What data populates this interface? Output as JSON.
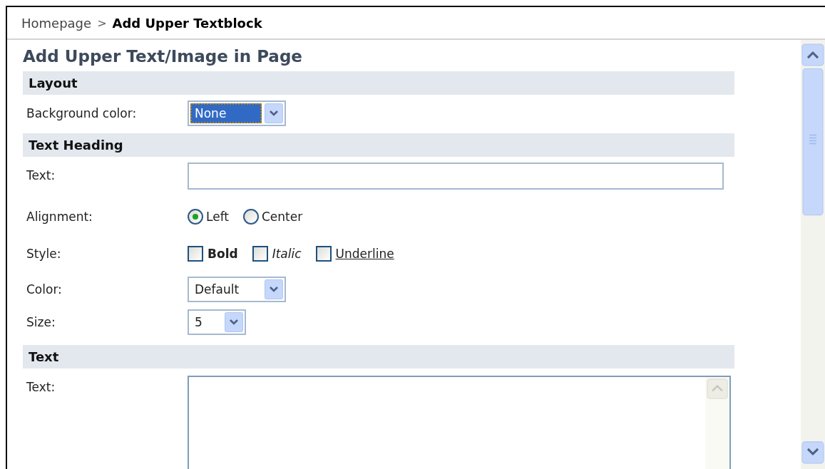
{
  "breadcrumb": {
    "parent": "Homepage",
    "separator": ">",
    "current": "Add Upper Textblock"
  },
  "title": "Add Upper Text/Image in Page",
  "sections": [
    {
      "heading": "Layout",
      "fields": [
        {
          "kind": "select",
          "label": "Background color:",
          "value": "None",
          "focused": true
        }
      ]
    },
    {
      "heading": "Text Heading",
      "fields": [
        {
          "kind": "text",
          "label": "Text:"
        },
        {
          "kind": "radio",
          "label": "Alignment:",
          "options": [
            {
              "label": "Left",
              "selected": true
            },
            {
              "label": "Center",
              "selected": false
            }
          ]
        },
        {
          "kind": "checkboxes",
          "label": "Style:",
          "options": [
            {
              "label": "Bold",
              "checked": false
            },
            {
              "label": "Italic",
              "checked": false
            },
            {
              "label": "Underline",
              "checked": false
            }
          ]
        },
        {
          "kind": "select",
          "label": "Color:",
          "value": "Default",
          "focused": false
        },
        {
          "kind": "select",
          "label": "Size:",
          "value": "5",
          "focused": false
        }
      ]
    },
    {
      "heading": "Text",
      "fields": [
        {
          "kind": "textarea",
          "label": "Text:"
        }
      ]
    }
  ]
}
